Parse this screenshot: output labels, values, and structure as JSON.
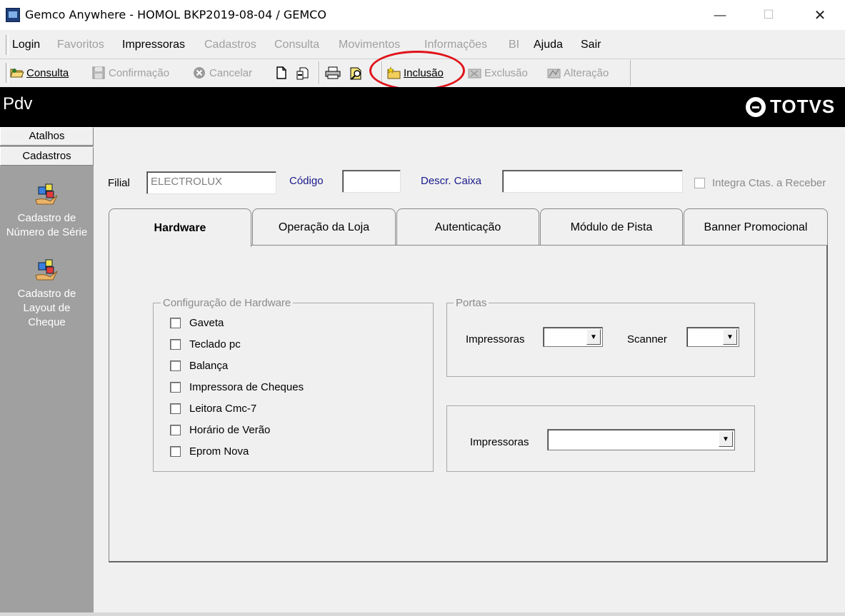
{
  "window": {
    "title": "Gemco Anywhere - HOMOL BKP2019-08-04 / GEMCO"
  },
  "menu": [
    {
      "label": "Login",
      "enabled": true
    },
    {
      "label": "Favoritos",
      "enabled": false
    },
    {
      "label": "Impressoras",
      "enabled": true
    },
    {
      "label": "Cadastros",
      "enabled": false
    },
    {
      "label": "Consulta",
      "enabled": false
    },
    {
      "label": "Movimentos",
      "enabled": false
    },
    {
      "label": "Informações",
      "enabled": false
    },
    {
      "label": "BI",
      "enabled": false
    },
    {
      "label": "Ajuda",
      "enabled": true
    },
    {
      "label": "Sair",
      "enabled": true
    }
  ],
  "toolbar": {
    "consulta": "Consulta",
    "confirmacao": "Confirmação",
    "cancelar": "Cancelar",
    "inclusao": "Inclusão",
    "exclusao": "Exclusão",
    "alteracao": "Alteração"
  },
  "header": {
    "title": "Pdv",
    "brand": "TOTVS"
  },
  "sidebar": {
    "tabs": [
      "Atalhos",
      "Cadastros"
    ],
    "entries": [
      {
        "line1": "Cadastro de",
        "line2": "Número de Série"
      },
      {
        "line1": "Cadastro de",
        "line2": "Layout de",
        "line3": "Cheque"
      }
    ]
  },
  "form": {
    "filial_label": "Filial",
    "filial_value": "ELECTROLUX",
    "codigo_label": "Código",
    "codigo_value": "",
    "caixa_label": "Descr. Caixa",
    "caixa_value": "",
    "integra_label": "Integra Ctas. a Receber"
  },
  "tabs": [
    "Hardware",
    "Operação da Loja",
    "Autenticação",
    "Módulo de Pista",
    "Banner Promocional"
  ],
  "active_tab": "Hardware",
  "hardware": {
    "group_title": "Configuração de Hardware",
    "options": [
      "Gaveta",
      "Teclado pc",
      "Balança",
      "Impressora de Cheques",
      "Leitora Cmc-7",
      "Horário de Verão",
      "Eprom Nova"
    ]
  },
  "portas": {
    "group_title": "Portas",
    "impressoras_label": "Impressoras",
    "impressoras_value": "",
    "scanner_label": "Scanner",
    "scanner_value": ""
  },
  "impressoras_box": {
    "label": "Impressoras",
    "value": ""
  },
  "colors": {
    "highlight": "#e0141b",
    "header_bg": "#000000",
    "sidebar_bg": "#a0a0a0",
    "label_blue": "#1a1a8c"
  }
}
